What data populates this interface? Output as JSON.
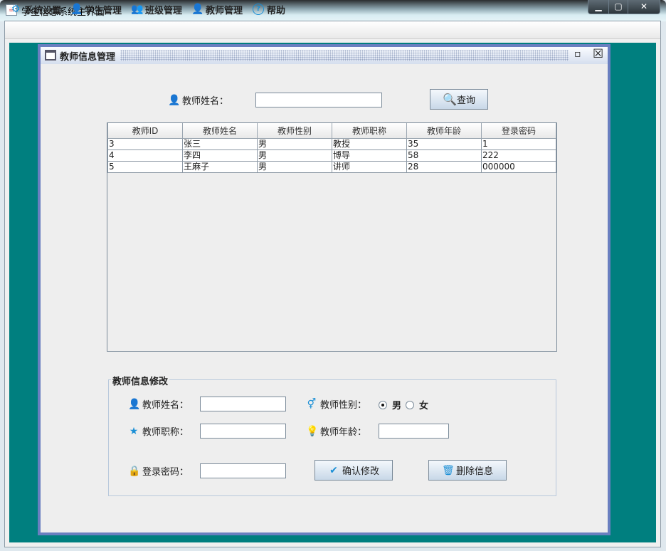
{
  "window": {
    "title": "学生信息系统主界面",
    "minimize": "▁",
    "maximize": "▢",
    "close": "✕"
  },
  "menu": [
    {
      "label": "系统设置",
      "icon": "gear-icon",
      "glyph": "⚙"
    },
    {
      "label": "学生管理",
      "icon": "student-icon",
      "glyph": "👤"
    },
    {
      "label": "班级管理",
      "icon": "class-icon",
      "glyph": "👥"
    },
    {
      "label": "教师管理",
      "icon": "teacher-icon",
      "glyph": "👤"
    },
    {
      "label": "帮助",
      "icon": "help-icon",
      "glyph": "?"
    }
  ],
  "internal_frame": {
    "title": "教师信息管理",
    "restore": "▫",
    "close": "☒"
  },
  "search": {
    "label": "教师姓名：",
    "value": "",
    "button": "查询"
  },
  "table": {
    "columns": [
      "教师ID",
      "教师姓名",
      "教师性别",
      "教师职称",
      "教师年龄",
      "登录密码"
    ],
    "rows": [
      [
        "3",
        "张三",
        "男",
        "教授",
        "35",
        "1"
      ],
      [
        "4",
        "李四",
        "男",
        "博导",
        "58",
        "222"
      ],
      [
        "5",
        "王麻子",
        "男",
        "讲师",
        "28",
        "000000"
      ]
    ]
  },
  "edit": {
    "title": "教师信息修改",
    "name_label": "教师姓名：",
    "name_value": "",
    "gender_label": "教师性别：",
    "gender_options": [
      "男",
      "女"
    ],
    "gender_selected": "男",
    "title_label": "教师职称：",
    "title_value": "",
    "age_label": "教师年龄：",
    "age_value": "",
    "password_label": "登录密码：",
    "password_value": "",
    "confirm_button": "确认修改",
    "delete_button": "删除信息"
  }
}
